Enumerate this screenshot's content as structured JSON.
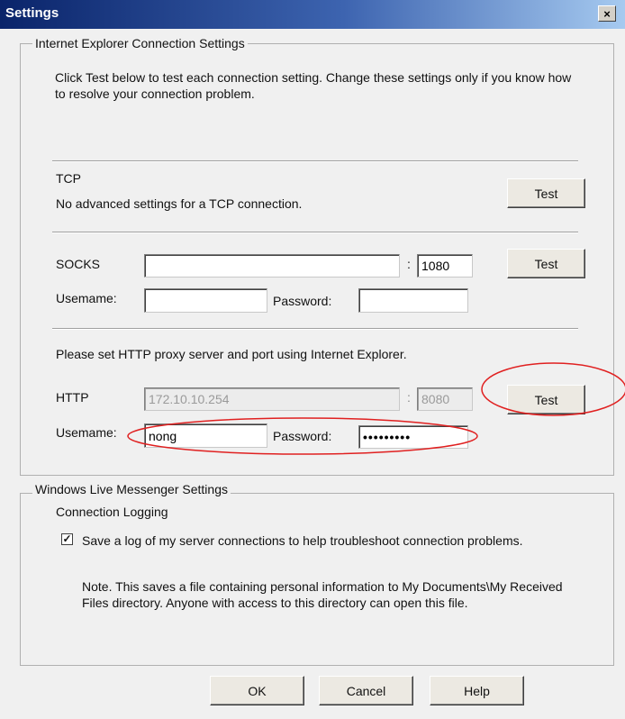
{
  "window": {
    "title": "Settings",
    "close": "×"
  },
  "ie_group": {
    "legend": "Internet Explorer Connection Settings",
    "description": "Click Test below to test each connection setting. Change these settings only if you know how to resolve your connection problem."
  },
  "tcp": {
    "label": "TCP",
    "note": "No advanced settings for a TCP connection.",
    "test_label": "Test"
  },
  "socks": {
    "label": "SOCKS",
    "server_value": "",
    "port_sep": ":",
    "port_value": "1080",
    "test_label": "Test",
    "username_label": "Usemame:",
    "username_value": "",
    "password_label": "Password:",
    "password_value": ""
  },
  "http": {
    "note": "Please set HTTP proxy server and port using Internet Explorer.",
    "label": "HTTP",
    "server_value": "172.10.10.254",
    "port_sep": ":",
    "port_value": "8080",
    "test_label": "Test",
    "username_label": "Usemame:",
    "username_value": "nong",
    "password_label": "Password:",
    "password_value": "•••••••••"
  },
  "wlm_group": {
    "legend": "Windows Live Messenger Settings",
    "logging_title": "Connection Logging",
    "checkbox_checked": true,
    "checkbox_mark": "✓",
    "checkbox_label": "Save a log of my server connections to help troubleshoot connection problems.",
    "note": "Note. This saves a file containing personal information to My Documents\\My Received Files directory. Anyone with access to this directory can open this file."
  },
  "footer": {
    "ok_label": "OK",
    "cancel_label": "Cancel",
    "help_label": "Help"
  },
  "annotation_color": "#e02020"
}
